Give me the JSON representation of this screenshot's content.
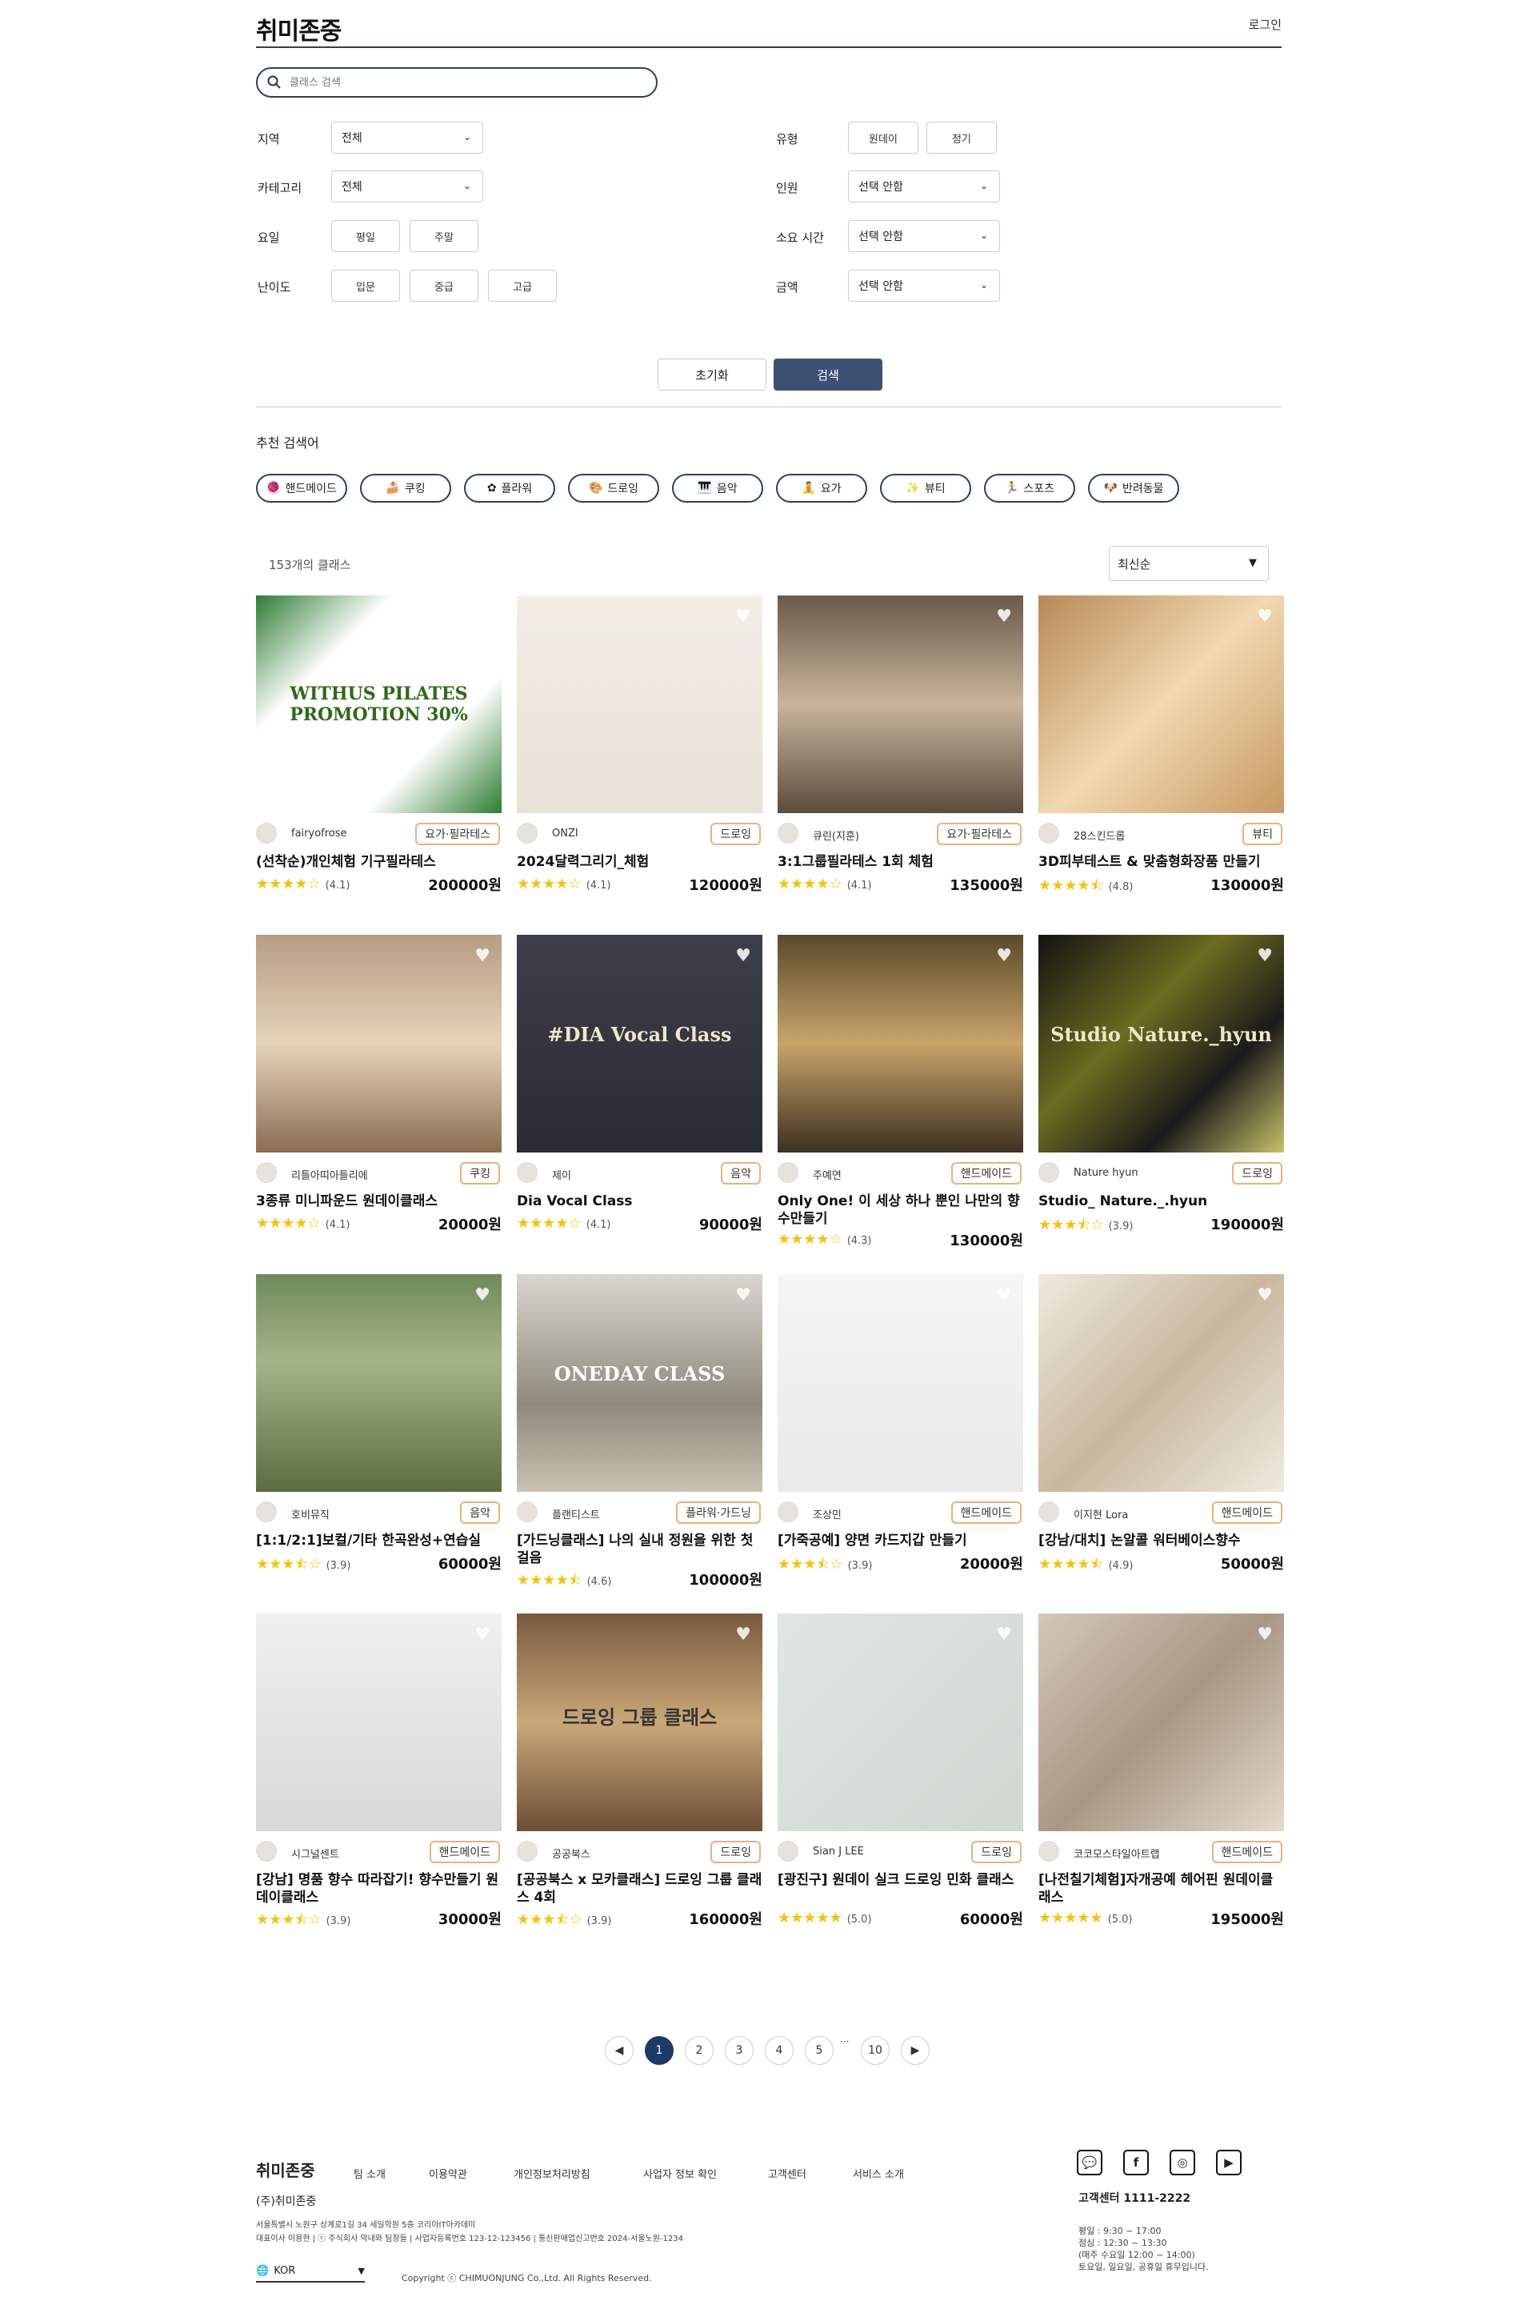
{
  "header": {
    "logo": "취미존중",
    "login": "로그인"
  },
  "search": {
    "placeholder": "클래스 검색"
  },
  "filters": {
    "region": {
      "label": "지역",
      "value": "전체"
    },
    "category": {
      "label": "카테고리",
      "value": "전체"
    },
    "day": {
      "label": "요일",
      "options": [
        "평일",
        "주말"
      ]
    },
    "level": {
      "label": "난이도",
      "options": [
        "입문",
        "중급",
        "고급"
      ]
    },
    "type": {
      "label": "유형",
      "options": [
        "원데이",
        "정기"
      ]
    },
    "people": {
      "label": "인원",
      "value": "선택 안함"
    },
    "duration": {
      "label": "소요 시간",
      "value": "선택 안함"
    },
    "price": {
      "label": "금액",
      "value": "선택 안함"
    },
    "reset": "초기화",
    "submit": "검색"
  },
  "recommend": {
    "title": "추천 검색어",
    "chips": [
      "핸드메이드",
      "쿠킹",
      "플라워",
      "드로잉",
      "음악",
      "요가",
      "뷰티",
      "스포츠",
      "반려동물"
    ]
  },
  "results": {
    "count": "153개의 클래스",
    "sort": "최신순"
  },
  "cards": [
    {
      "author": "fairyofrose",
      "category": "요가·필라테스",
      "title": "(선착순)개인체험 기구필라테스",
      "rating": "(4.1)",
      "price": "200000원",
      "img_text": "WITHUS PILATES PROMOTION 30%"
    },
    {
      "author": "ONZI",
      "category": "드로잉",
      "title": "2024달력그리기_체험",
      "rating": "(4.1)",
      "price": "120000원"
    },
    {
      "author": "큐린(지훈)",
      "category": "요가·필라테스",
      "title": "3:1그룹필라테스 1회 체험",
      "rating": "(4.1)",
      "price": "135000원"
    },
    {
      "author": "28스킨드롭",
      "category": "뷰티",
      "title": "3D피부테스트 & 맞춤형화장품 만들기",
      "rating": "(4.8)",
      "price": "130000원"
    },
    {
      "author": "리틀아띠아틀리에",
      "category": "쿠킹",
      "title": "3종류 미니파운드 원데이클래스",
      "rating": "(4.1)",
      "price": "20000원"
    },
    {
      "author": "제이",
      "category": "음악",
      "title": "Dia Vocal Class",
      "rating": "(4.1)",
      "price": "90000원",
      "img_text": "#DIA Vocal Class"
    },
    {
      "author": "주예연",
      "category": "핸드메이드",
      "title": "Only One! 이 세상 하나 뿐인 나만의 향수만들기",
      "rating": "(4.3)",
      "price": "130000원"
    },
    {
      "author": "Nature hyun",
      "category": "드로잉",
      "title": "Studio_ Nature._.hyun",
      "rating": "(3.9)",
      "price": "190000원",
      "img_text": "Studio Nature._hyun"
    },
    {
      "author": "호비뮤직",
      "category": "음악",
      "title": "[1:1/2:1]보컬/기타 한곡완성+연습실",
      "rating": "(3.9)",
      "price": "60000원"
    },
    {
      "author": "플랜티스트",
      "category": "플라워·가드닝",
      "title": "[가드닝클래스] 나의 실내 정원을 위한 첫 걸음",
      "rating": "(4.6)",
      "price": "100000원",
      "img_text": "ONEDAY CLASS"
    },
    {
      "author": "조상민",
      "category": "핸드메이드",
      "title": "[가죽공예] 양면 카드지갑 만들기",
      "rating": "(3.9)",
      "price": "20000원"
    },
    {
      "author": "이지현 Lora",
      "category": "핸드메이드",
      "title": "[강남/대치] 논알콜 워터베이스향수",
      "rating": "(4.9)",
      "price": "50000원"
    },
    {
      "author": "시그널센트",
      "category": "핸드메이드",
      "title": "[강남] 명품 향수 따라잡기! 향수만들기 원데이클래스",
      "rating": "(3.9)",
      "price": "30000원"
    },
    {
      "author": "공공북스",
      "category": "드로잉",
      "title": "[공공북스 x 모카클래스] 드로잉 그룹 클래스 4회",
      "rating": "(3.9)",
      "price": "160000원",
      "img_text": "드로잉 그룹 클래스"
    },
    {
      "author": "Sian J LEE",
      "category": "드로잉",
      "title": "[광진구] 원데이 실크 드로잉 민화 클래스",
      "rating": "(5.0)",
      "price": "60000원"
    },
    {
      "author": "코코모스타일아트랩",
      "category": "핸드메이드",
      "title": "[나전칠기체험]자개공예 헤어핀 원데이클래스",
      "rating": "(5.0)",
      "price": "195000원"
    }
  ],
  "pagination": {
    "pages": [
      "1",
      "2",
      "3",
      "4",
      "5",
      "10"
    ],
    "ellipsis": "···"
  },
  "footer": {
    "logo": "취미존중",
    "nav": [
      "팀 소개",
      "이용약관",
      "개인정보처리방침",
      "사업자 정보 확인",
      "고객센터",
      "서비스 소개"
    ],
    "company": "(주)취미존중",
    "addr1": "서울특별시 노원구 상계로1길 34 세일학원 5층 코리아IT아카데미",
    "addr2": "대표이사 이용현 | ⓒ 주식회사 악내와 팀장들 | 사업자등록번호 123-12-123456 | 통신판매업신고번호 2024-서울노원-1234",
    "lang": "KOR",
    "copyright": "Copyright ⓒ CHIMUONJUNG Co.,Ltd. All Rights Reserved.",
    "cs": "고객센터 1111-2222",
    "hours": "평일 : 9:30 ~ 17:00\n점심 : 12:30 ~ 13:30\n(매주 수요일 12:00 ~ 14:00)\n토요일, 일요일, 공휴일 휴무입니다."
  }
}
